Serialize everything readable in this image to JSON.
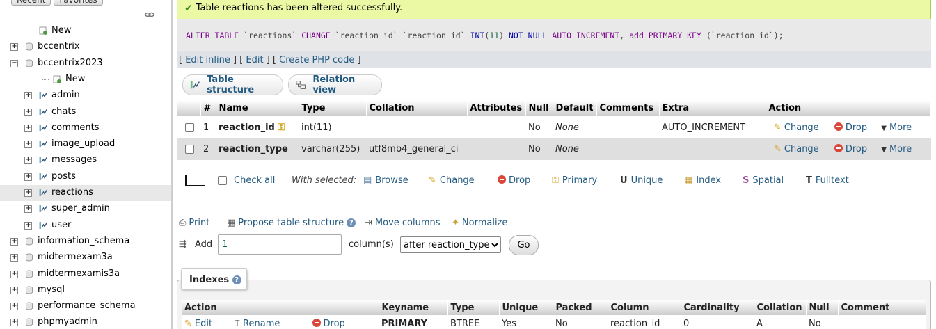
{
  "nav": {
    "tabs": [
      "Recent",
      "Favorites"
    ],
    "items": [
      {
        "label": "New",
        "level": 1,
        "kind": "new"
      },
      {
        "label": "bccentrix",
        "level": 0,
        "kind": "db",
        "expanded": false
      },
      {
        "label": "bccentrix2023",
        "level": 0,
        "kind": "db",
        "expanded": true
      },
      {
        "label": "New",
        "level": 2,
        "kind": "new"
      },
      {
        "label": "admin",
        "level": 1,
        "kind": "table"
      },
      {
        "label": "chats",
        "level": 1,
        "kind": "table"
      },
      {
        "label": "comments",
        "level": 1,
        "kind": "table"
      },
      {
        "label": "image_upload",
        "level": 1,
        "kind": "table"
      },
      {
        "label": "messages",
        "level": 1,
        "kind": "table"
      },
      {
        "label": "posts",
        "level": 1,
        "kind": "table"
      },
      {
        "label": "reactions",
        "level": 1,
        "kind": "table",
        "selected": true
      },
      {
        "label": "super_admin",
        "level": 1,
        "kind": "table"
      },
      {
        "label": "user",
        "level": 1,
        "kind": "table"
      },
      {
        "label": "information_schema",
        "level": 0,
        "kind": "db"
      },
      {
        "label": "midtermexam3a",
        "level": 0,
        "kind": "db"
      },
      {
        "label": "midtermexamis3a",
        "level": 0,
        "kind": "db"
      },
      {
        "label": "mysql",
        "level": 0,
        "kind": "db"
      },
      {
        "label": "performance_schema",
        "level": 0,
        "kind": "db"
      },
      {
        "label": "phpmyadmin",
        "level": 0,
        "kind": "db"
      }
    ]
  },
  "message": {
    "text": "Table reactions has been altered successfully."
  },
  "sql": {
    "parts": [
      {
        "t": "ALTER TABLE",
        "c": "kw"
      },
      {
        "t": " `reactions` ",
        "c": "str"
      },
      {
        "t": "CHANGE",
        "c": "kw"
      },
      {
        "t": " `reaction_id` `reaction_id` ",
        "c": "str"
      },
      {
        "t": "INT",
        "c": "kw2"
      },
      {
        "t": "(",
        "c": "str"
      },
      {
        "t": "11",
        "c": "num"
      },
      {
        "t": ") ",
        "c": "str"
      },
      {
        "t": "NOT NULL",
        "c": "kw2"
      },
      {
        "t": " ",
        "c": "str"
      },
      {
        "t": "AUTO_INCREMENT",
        "c": "kw"
      },
      {
        "t": ", ",
        "c": "str"
      },
      {
        "t": "add PRIMARY KEY",
        "c": "kw"
      },
      {
        "t": " (`reaction_id`);",
        "c": "str"
      }
    ],
    "links": {
      "edit_inline": "Edit inline",
      "edit": "Edit",
      "create_php": "Create PHP code"
    }
  },
  "subtabs": {
    "structure": "Table structure",
    "relation": "Relation view"
  },
  "structure": {
    "headers": [
      "#",
      "Name",
      "Type",
      "Collation",
      "Attributes",
      "Null",
      "Default",
      "Comments",
      "Extra",
      "Action"
    ],
    "rows": [
      {
        "num": "1",
        "name": "reaction_id",
        "type": "int(11)",
        "collation": "",
        "attributes": "",
        "null": "No",
        "default": "None",
        "comments": "",
        "extra": "AUTO_INCREMENT"
      },
      {
        "num": "2",
        "name": "reaction_type",
        "type": "varchar(255)",
        "collation": "utf8mb4_general_ci",
        "attributes": "",
        "null": "No",
        "default": "None",
        "comments": "",
        "extra": ""
      }
    ],
    "actions": {
      "change": "Change",
      "drop": "Drop",
      "more": "More"
    }
  },
  "bulk": {
    "check_all": "Check all",
    "with_selected": "With selected:",
    "browse": "Browse",
    "change": "Change",
    "drop": "Drop",
    "primary": "Primary",
    "unique": "Unique",
    "index": "Index",
    "spatial": "Spatial",
    "fulltext": "Fulltext"
  },
  "tools": {
    "print": "Print",
    "propose": "Propose table structure",
    "move": "Move columns",
    "normalize": "Normalize"
  },
  "add": {
    "label": "Add",
    "count": "1",
    "columns_label": "column(s)",
    "position": "after reaction_type",
    "go": "Go"
  },
  "indexes": {
    "title": "Indexes",
    "headers": [
      "Action",
      "Keyname",
      "Type",
      "Unique",
      "Packed",
      "Column",
      "Cardinality",
      "Collation",
      "Null",
      "Comment"
    ],
    "row": {
      "edit": "Edit",
      "rename": "Rename",
      "drop": "Drop",
      "keyname": "PRIMARY",
      "type": "BTREE",
      "unique": "Yes",
      "packed": "No",
      "column": "reaction_id",
      "cardinality": "0",
      "collation": "A",
      "null": "No",
      "comment": ""
    }
  }
}
